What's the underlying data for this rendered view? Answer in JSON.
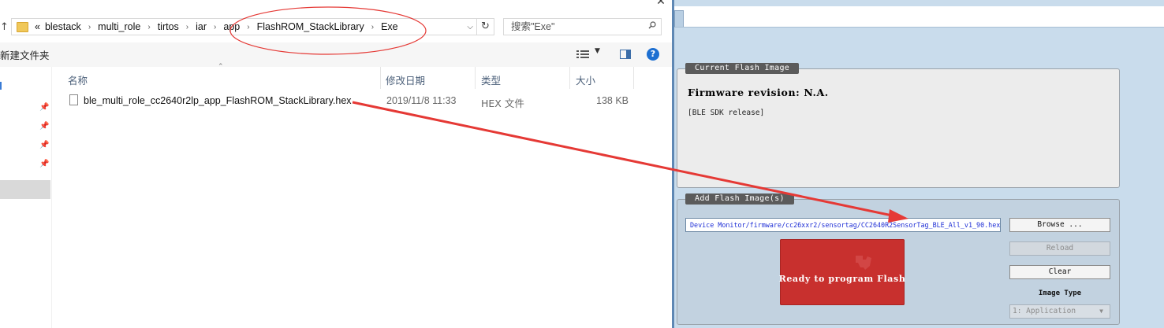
{
  "explorer": {
    "close_glyph": "✕",
    "up_glyph": "↑",
    "breadcrumb": {
      "prefix": "«",
      "items": [
        "blestack",
        "multi_role",
        "tirtos",
        "iar",
        "app",
        "FlashROM_StackLibrary",
        "Exe"
      ],
      "separator": "›"
    },
    "search_placeholder": "搜索\"Exe\"",
    "toolbar": {
      "new_folder": "新建文件夹"
    },
    "columns": {
      "name": "名称",
      "modified": "修改日期",
      "type": "类型",
      "size": "大小"
    },
    "files": [
      {
        "name": "ble_multi_role_cc2640r2lp_app_FlashROM_StackLibrary.hex",
        "modified": "2019/11/8 11:33",
        "type": "HEX 文件",
        "size": "138 KB"
      }
    ]
  },
  "programmer": {
    "current_flash_image": {
      "title": "Current Flash Image",
      "firmware_revision": "Firmware revision: N.A.",
      "sdk_release": "[BLE SDK release]"
    },
    "add_flash_image": {
      "title": "Add Flash Image(s)",
      "path": "Device Monitor/firmware/cc26xxr2/sensortag/CC2640R2SensorTag_BLE_All_v1_90.hex",
      "browse_label": "Browse ...",
      "reload_label": "Reload",
      "clear_label": "Clear",
      "image_type_label": "Image Type",
      "image_type_value": "1: Application",
      "status_text": "Ready to program Flash"
    }
  },
  "colors": {
    "annotation_red": "#e53935",
    "status_red": "#c8302e",
    "panel_blue": "#c9dcec",
    "group_title_bg": "#5b5b5b"
  }
}
